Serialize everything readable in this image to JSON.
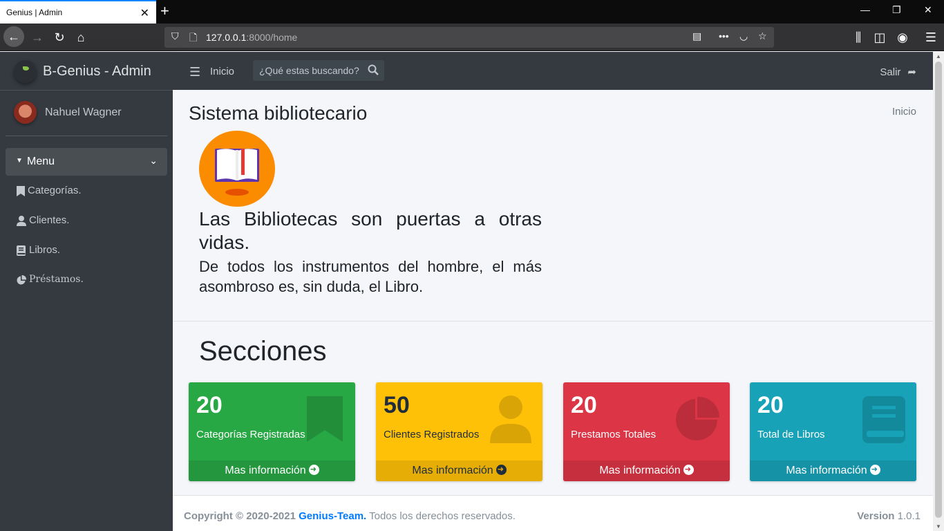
{
  "browser": {
    "tab_title": "Genius | Admin",
    "url_host": "127.0.0.1",
    "url_rest": ":8000/home"
  },
  "sidebar": {
    "brand": "B-Genius - Admin",
    "user_name": "Nahuel Wagner",
    "menu_label": "Menu",
    "items": [
      {
        "label": "Categorías.",
        "icon": "bookmark-icon"
      },
      {
        "label": "Clientes.",
        "icon": "user-icon"
      },
      {
        "label": "Libros.",
        "icon": "book-icon"
      },
      {
        "label": "Préstamos.",
        "icon": "pie-chart-icon"
      }
    ]
  },
  "header": {
    "home_link": "Inicio",
    "search_placeholder": "¿Qué estas buscando?",
    "logout": "Salir"
  },
  "content": {
    "title": "Sistema bibliotecario",
    "breadcrumb": "Inicio",
    "quote_main": "Las Bibliotecas son puertas a otras vidas.",
    "quote_sub": "De todos los instrumentos del hombre, el más asombroso es, sin duda, el Libro.",
    "sections_title": "Secciones",
    "boxes": [
      {
        "count": "20",
        "label": "Categorías Registradas",
        "more": "Mas información",
        "color": "#28a745",
        "icon": "bookmark-icon"
      },
      {
        "count": "50",
        "label": "Clientes Registrados",
        "more": "Mas información",
        "color": "#ffc107",
        "icon": "user-icon"
      },
      {
        "count": "20",
        "label": "Prestamos Totales",
        "more": "Mas información",
        "color": "#dc3545",
        "icon": "pie-chart-icon"
      },
      {
        "count": "20",
        "label": "Total de Libros",
        "more": "Mas información",
        "color": "#17a2b8",
        "icon": "book-icon"
      }
    ]
  },
  "footer": {
    "copyright": "Copyright © 2020-2021",
    "team": "Genius-Team.",
    "rights": "Todos los derechos reservados.",
    "version_label": "Version",
    "version": "1.0.1"
  }
}
